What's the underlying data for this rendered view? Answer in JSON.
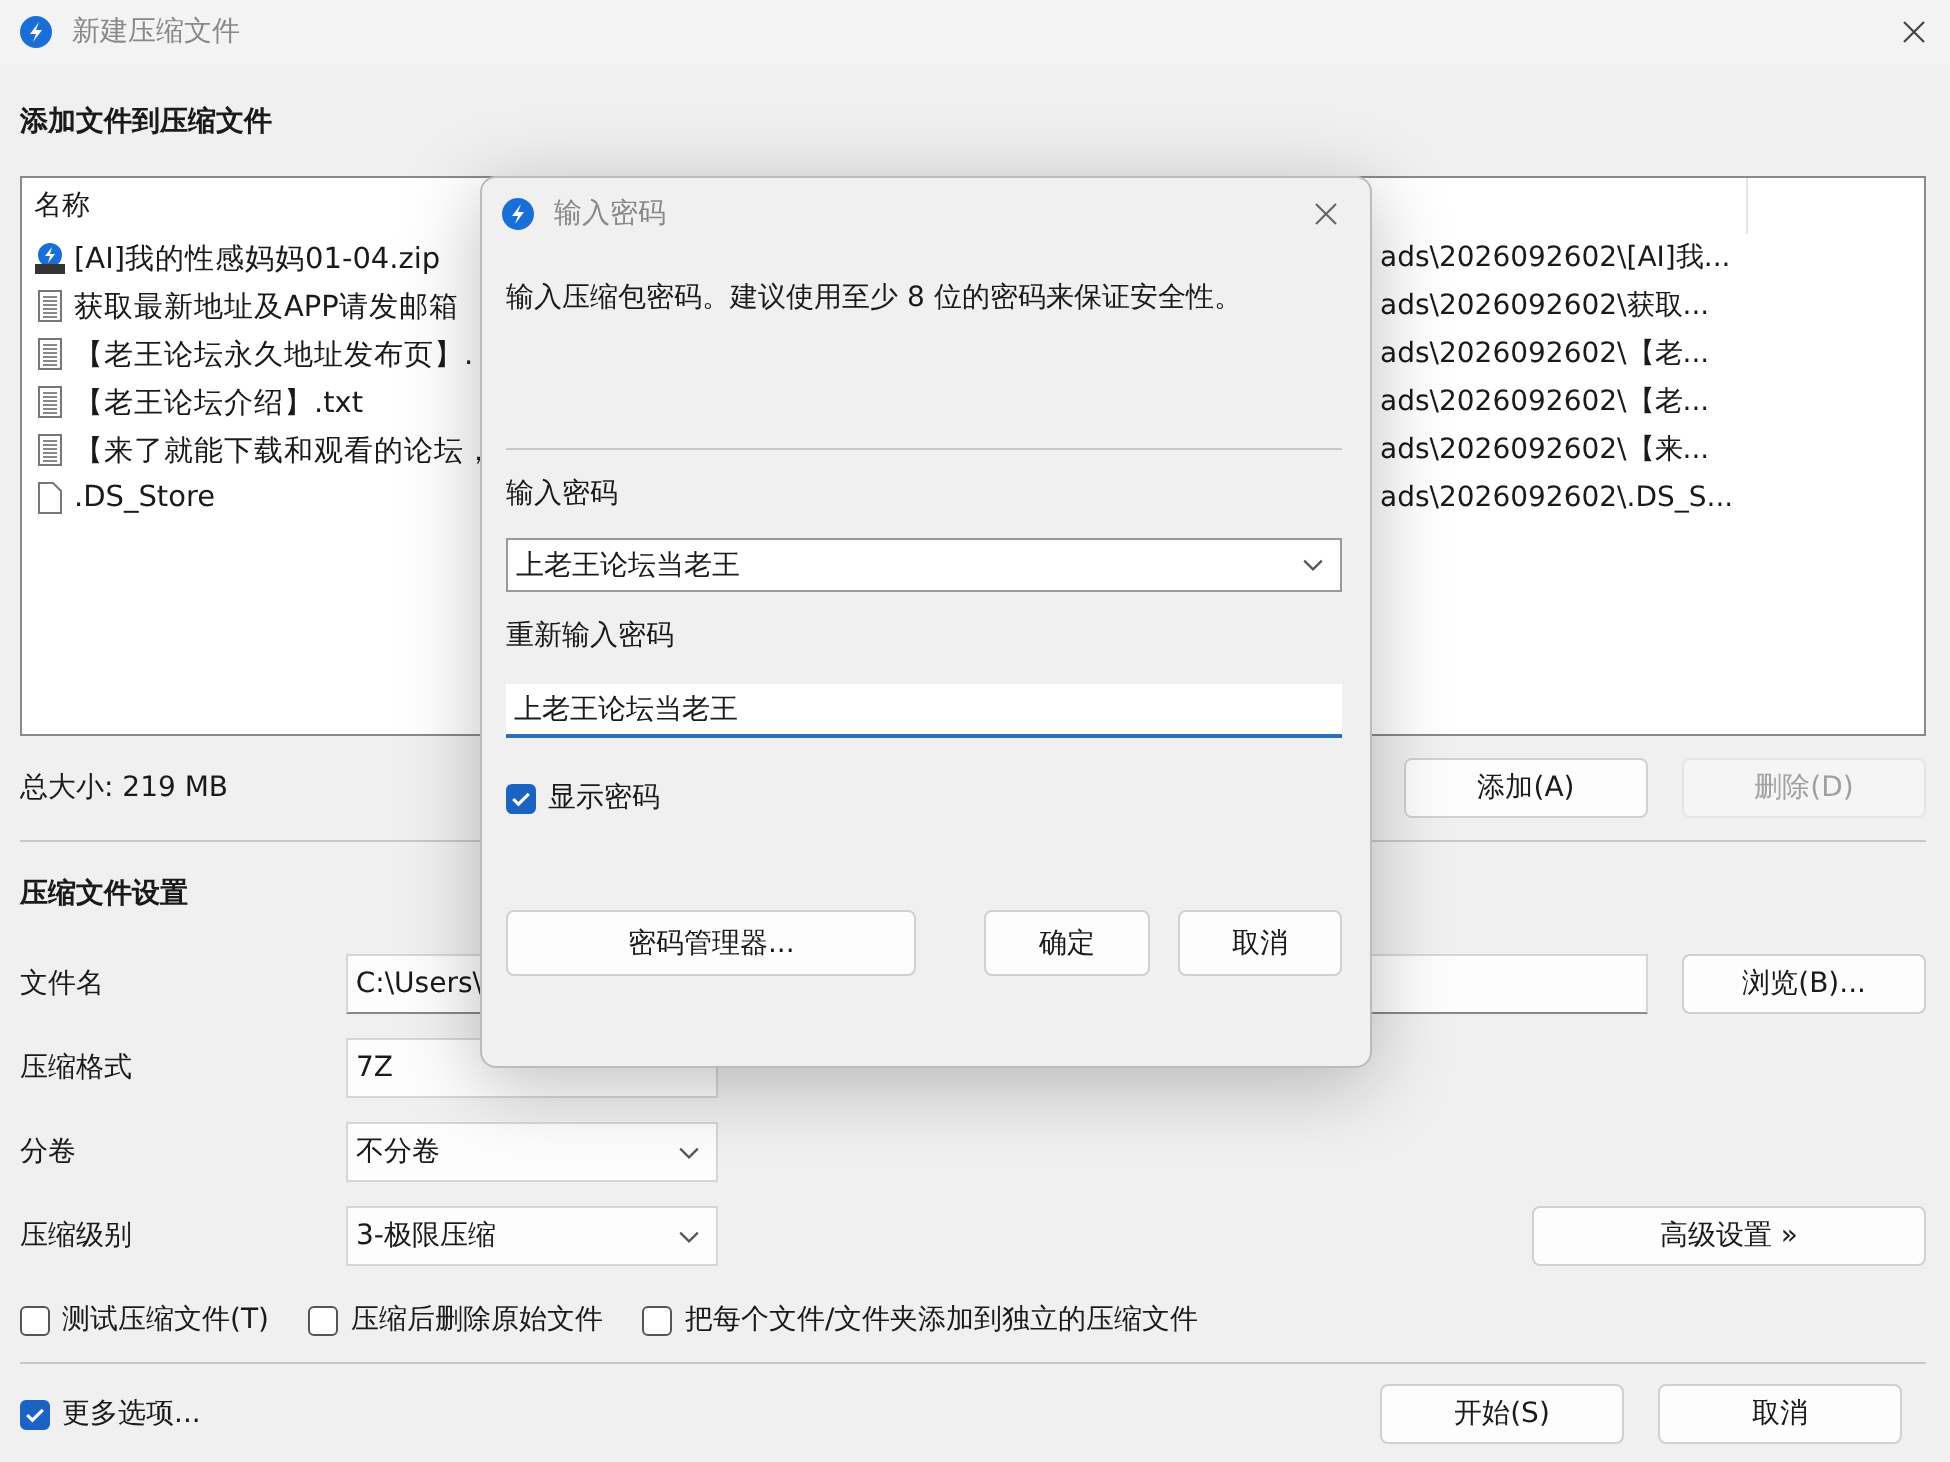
{
  "window": {
    "title": "新建压缩文件"
  },
  "add_section": {
    "heading": "添加文件到压缩文件",
    "list": {
      "column_header": "名称",
      "rows": [
        {
          "kind": "zip",
          "name": "[AI]我的性感妈妈01-04.zip",
          "path": "ads\\2026092602\\[AI]我..."
        },
        {
          "kind": "text",
          "name": "获取最新地址及APP请发邮箱",
          "path": "ads\\2026092602\\获取..."
        },
        {
          "kind": "text",
          "name": "【老王论坛永久地址发布页】.",
          "path": "ads\\2026092602\\【老..."
        },
        {
          "kind": "text",
          "name": "【老王论坛介绍】.txt",
          "path": "ads\\2026092602\\【老..."
        },
        {
          "kind": "text",
          "name": "【来了就能下载和观看的论坛，",
          "path": "ads\\2026092602\\【来..."
        },
        {
          "kind": "blank",
          "name": ".DS_Store",
          "path": "ads\\2026092602\\.DS_S..."
        }
      ]
    },
    "total_size": "总大小: 219 MB",
    "buttons": [
      {
        "label": "添加(A)",
        "disabled": false
      },
      {
        "label": "删除(D)",
        "disabled": true
      }
    ]
  },
  "settings": {
    "heading": "压缩文件设置",
    "filename": {
      "label": "文件名",
      "value": "C:\\Users\\"
    },
    "browse_button": "浏览(B)...",
    "format": {
      "label": "压缩格式",
      "value": "7Z"
    },
    "split": {
      "label": "分卷",
      "value": "不分卷"
    },
    "level": {
      "label": "压缩级别",
      "value": "3-极限压缩"
    },
    "advanced_button": "高级设置 »",
    "options": [
      {
        "label": "测试压缩文件(T)",
        "checked": false
      },
      {
        "label": "压缩后删除原始文件",
        "checked": false
      },
      {
        "label": "把每个文件/文件夹添加到独立的压缩文件",
        "checked": false
      }
    ]
  },
  "footer": {
    "more_options": {
      "label": "更多选项...",
      "checked": true
    },
    "buttons": [
      "开始(S)",
      "取消"
    ]
  },
  "dialog": {
    "title": "输入密码",
    "message": "输入压缩包密码。建议使用至少 8 位的密码来保证安全性。",
    "password": {
      "label": "输入密码",
      "value": "上老王论坛当老王"
    },
    "confirm": {
      "label": "重新输入密码",
      "value": "上老王论坛当老王"
    },
    "show_password": {
      "label": "显示密码",
      "checked": true
    },
    "buttons": [
      "密码管理器...",
      "确定",
      "取消"
    ]
  }
}
